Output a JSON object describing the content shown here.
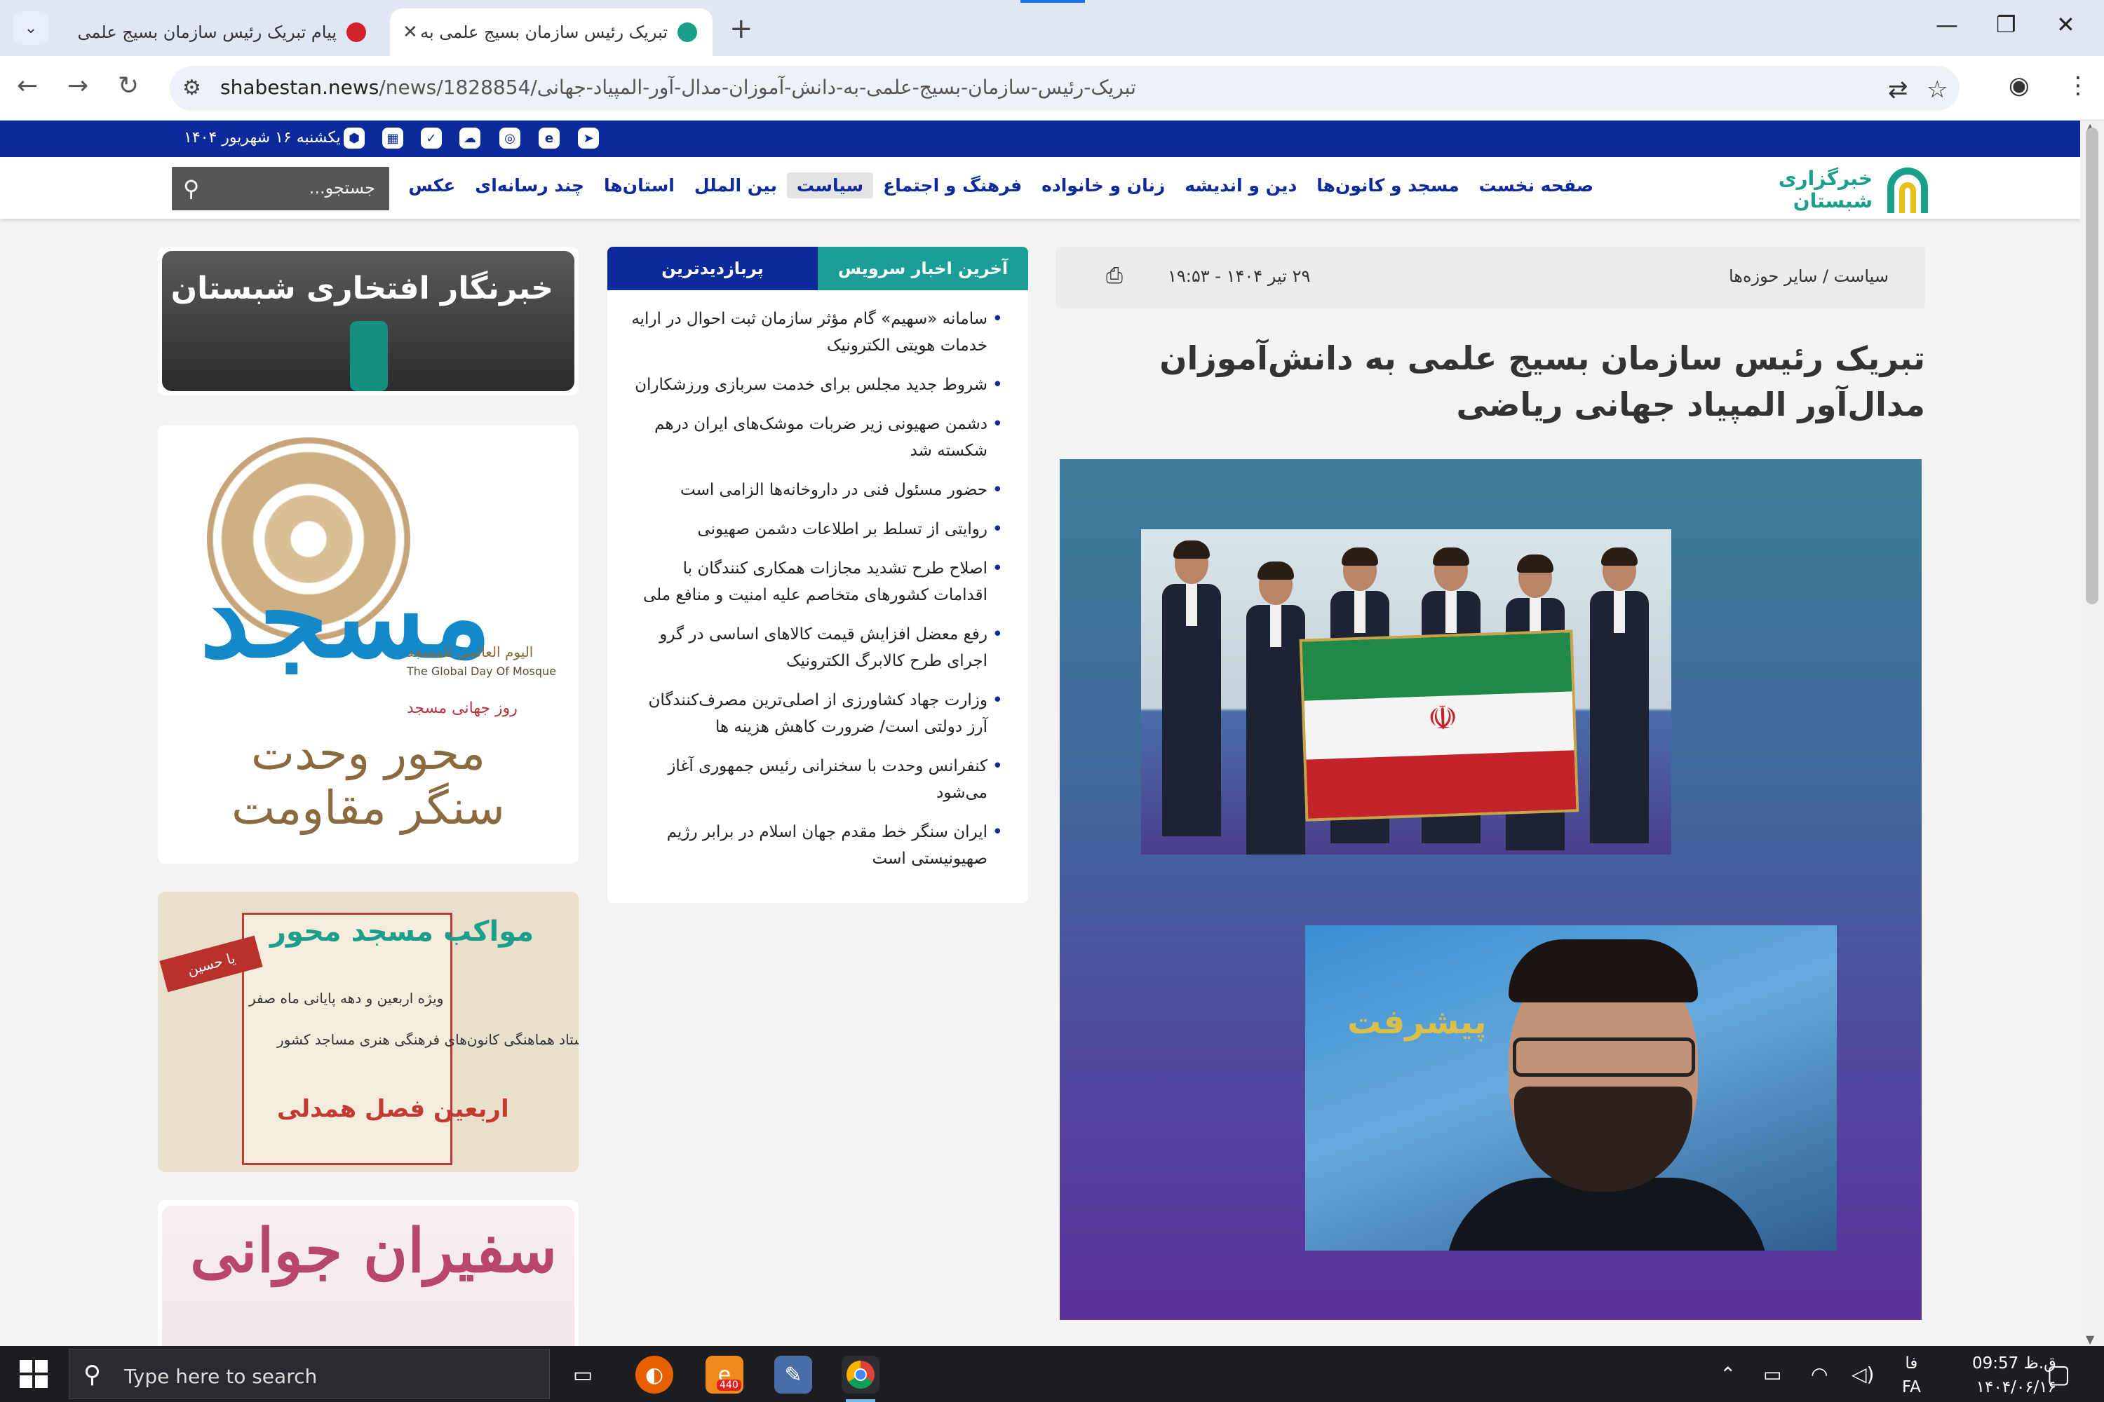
{
  "browser": {
    "tabs": [
      {
        "title": "پیام تبریک رئیس سازمان بسیج علمی به",
        "active": false
      },
      {
        "title": "تبریک رئیس سازمان بسیج علمی به",
        "active": true
      }
    ],
    "url_host": "shabestan.news",
    "url_path": "/news/1828854/تبریک-رئیس-سازمان-بسیج-علمی-به-دانش-آموزان-مدال-آور-المپیاد-جهانی"
  },
  "site": {
    "date": "یکشنبه ۱۶ شهریور ۱۴۰۴",
    "logo_line1": "خبرگزاری",
    "logo_line2": "شبستان",
    "menu": [
      {
        "label": "صفحه نخست",
        "active": false
      },
      {
        "label": "مسجد و کانون‌ها",
        "active": false
      },
      {
        "label": "دین و اندیشه",
        "active": false
      },
      {
        "label": "زنان و خانواده",
        "active": false
      },
      {
        "label": "فرهنگ و اجتماع",
        "active": false
      },
      {
        "label": "سیاست",
        "active": true
      },
      {
        "label": "بین الملل",
        "active": false
      },
      {
        "label": "استان‌ها",
        "active": false
      },
      {
        "label": "چند رسانه‌ای",
        "active": false
      },
      {
        "label": "عکس",
        "active": false
      }
    ],
    "search_placeholder": "جستجو..."
  },
  "article": {
    "breadcrumb": "سیاست  /  سایر حوزه‌ها",
    "timestamp": "۲۹ تیر ۱۴۰۴ - ۱۹:۵۳",
    "headline": "تبریک رئیس سازمان بسیج علمی به دانش‌آموزان مدال‌آور المپیاد جهانی ریاضی",
    "image_text": "پیشرفت"
  },
  "sidebar": {
    "tab_latest": "آخرین اخبار سرویس",
    "tab_popular": "پربازدیدترین",
    "news": [
      "سامانه «سهیم» گام مؤثر سازمان ثبت احوال در ارایه خدمات هویتی الکترونیک",
      "شروط جدید مجلس برای خدمت سربازی ورزشکاران",
      "دشمن صهیونی زیر ضربات موشک‌های ایران درهم شکسته شد",
      "حضور مسئول فنی در داروخانه‌ها الزامی است",
      "روایتی از تسلط بر اطلاعات دشمن صهیونی",
      "اصلاح طرح تشدید مجازات همکاری کنندگان با اقدامات کشورهای متخاصم علیه امنیت و منافع ملی",
      "رفع معضل افزایش قیمت کالاهای اساسی در گرو اجرای طرح کالابرگ الکترونیک",
      "وزارت جهاد کشاورزی از اصلی‌ترین مصرف‌کنندگان آرز دولتی است/ ضرورت کاهش هزینه ها",
      "کنفرانس وحدت با سخنرانی رئیس جمهوری آغاز می‌شود",
      "ایران سنگر خط مقدم جهان اسلام در برابر رژیم صهیونیستی است"
    ]
  },
  "ads": {
    "ad1_text": "خبرنگار افتخاری شبستان شوید",
    "ad2_big": "مسجد",
    "ad2_ar": "اليوم العالمي للمسجد",
    "ad2_en": "The Global Day Of Mosque",
    "ad2_fa": "روز جهانی مسجد",
    "ad2_caption": "محور وحدت سنگر مقاومت",
    "ad3_ribbon": "یا حسین",
    "ad3_title": "مواکب مسجد محور",
    "ad3_sub": "ویژه اربعین و دهه پایانی ماه صفر",
    "ad3_org": "ستاد هماهنگی کانون‌های فرهنگی هنری مساجد کشور",
    "ad3_foot": "اربعین فصل همدلی",
    "ad4_text": "سفیران جوانی"
  },
  "taskbar": {
    "search_placeholder": "Type here to search",
    "badge": "440",
    "time": "09:57 ق.ظ",
    "date": "۱۴۰۴/۰۶/۱۶",
    "lang_top": "فا",
    "lang_bottom": "FA"
  }
}
